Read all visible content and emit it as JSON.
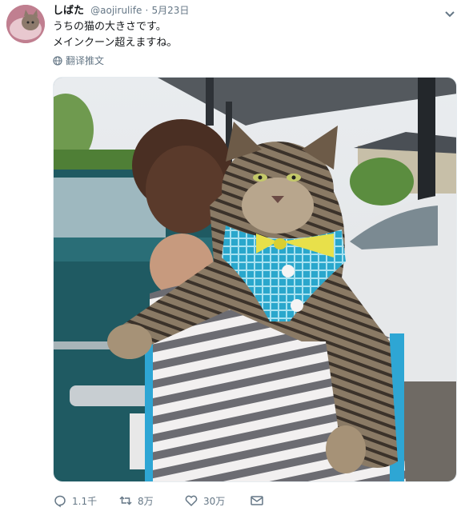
{
  "tweet": {
    "display_name": "しばた",
    "handle": "@aojirulife",
    "separator": "·",
    "date": "5月23日",
    "text_line1": "うちの猫の大きさです。",
    "text_line2": "メインクーン超えますね。",
    "translate_label": "翻译推文"
  },
  "actions": {
    "reply_count": "1.1千",
    "retweet_count": "8万",
    "like_count": "30万"
  },
  "colors": {
    "text_primary": "#14171a",
    "text_secondary": "#657786",
    "accent_blue": "#1da1f2"
  }
}
